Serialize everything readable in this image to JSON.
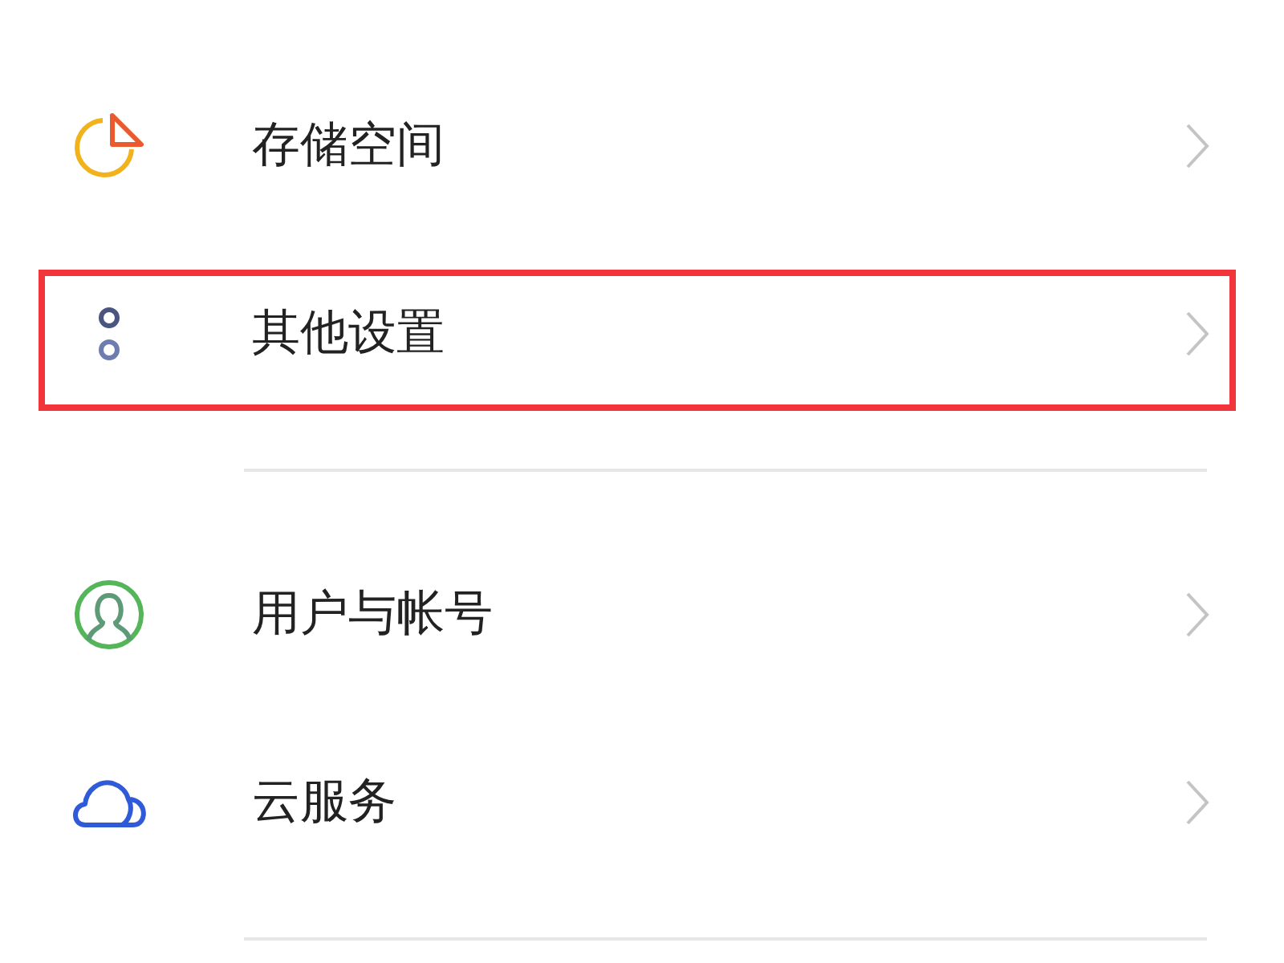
{
  "sections": [
    {
      "items": [
        {
          "kind": "storage",
          "label": "存储空间",
          "highlighted": false
        },
        {
          "kind": "other",
          "label": "其他设置",
          "highlighted": true
        }
      ]
    },
    {
      "items": [
        {
          "kind": "user",
          "label": "用户与帐号",
          "highlighted": false
        },
        {
          "kind": "cloud",
          "label": "云服务",
          "highlighted": false
        }
      ]
    }
  ]
}
